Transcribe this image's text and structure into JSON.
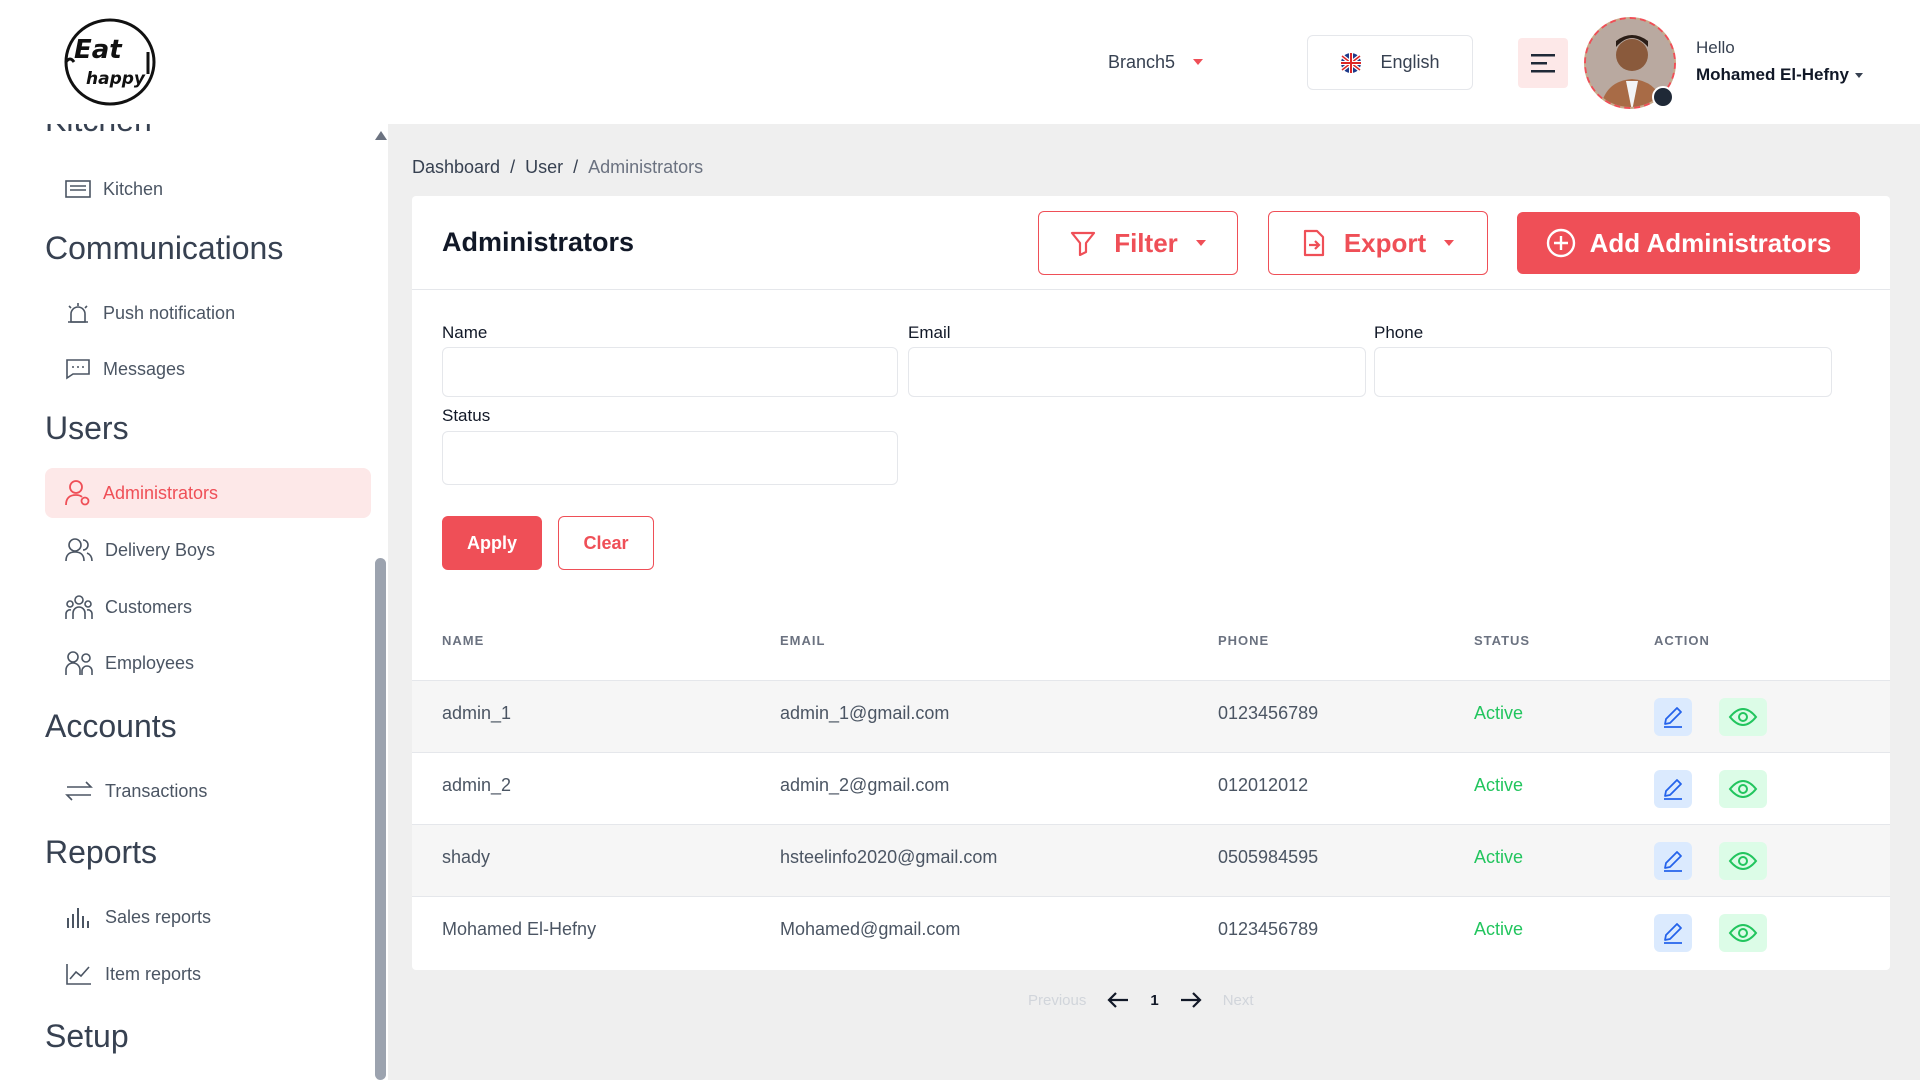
{
  "header": {
    "logo_text_1": "Eat",
    "logo_text_2": "happy",
    "branch": "Branch5",
    "language": "English",
    "greeting": "Hello",
    "user_name": "Mohamed El-Hefny"
  },
  "sidebar": {
    "sections": {
      "kitchen": "Kitchen",
      "communications": "Communications",
      "users": "Users",
      "accounts": "Accounts",
      "reports": "Reports",
      "setup": "Setup"
    },
    "items": {
      "kitchen": "Kitchen",
      "push_notification": "Push notification",
      "messages": "Messages",
      "administrators": "Administrators",
      "delivery_boys": "Delivery Boys",
      "customers": "Customers",
      "employees": "Employees",
      "transactions": "Transactions",
      "sales_reports": "Sales reports",
      "item_reports": "Item reports"
    }
  },
  "breadcrumb": [
    "Dashboard",
    "/",
    "User",
    "/",
    "Administrators"
  ],
  "card": {
    "title": "Administrators",
    "filter_label": "Filter",
    "export_label": "Export",
    "add_label": "Add Administrators"
  },
  "filters": {
    "name_label": "Name",
    "email_label": "Email",
    "phone_label": "Phone",
    "status_label": "Status",
    "apply_label": "Apply",
    "clear_label": "Clear"
  },
  "table": {
    "columns": [
      "NAME",
      "EMAIL",
      "PHONE",
      "STATUS",
      "ACTION"
    ],
    "rows": [
      {
        "name": "admin_1",
        "email": "admin_1@gmail.com",
        "phone": "0123456789",
        "status": "Active"
      },
      {
        "name": "admin_2",
        "email": "admin_2@gmail.com",
        "phone": "012012012",
        "status": "Active"
      },
      {
        "name": "shady",
        "email": "hsteelinfo2020@gmail.com",
        "phone": "0505984595",
        "status": "Active"
      },
      {
        "name": "Mohamed El-Hefny",
        "email": "Mohamed@gmail.com",
        "phone": "0123456789",
        "status": "Active"
      }
    ]
  },
  "pagination": {
    "previous": "Previous",
    "page": "1",
    "next": "Next"
  },
  "colors": {
    "accent": "#ef4f57",
    "status_active": "#22c55e",
    "edit_bg": "#dbeafe",
    "view_bg": "#dcfce7"
  },
  "icons": {
    "filter": "filter-icon",
    "export": "export-icon",
    "add": "plus-circle-icon",
    "edit": "pencil-icon",
    "view": "eye-icon"
  }
}
